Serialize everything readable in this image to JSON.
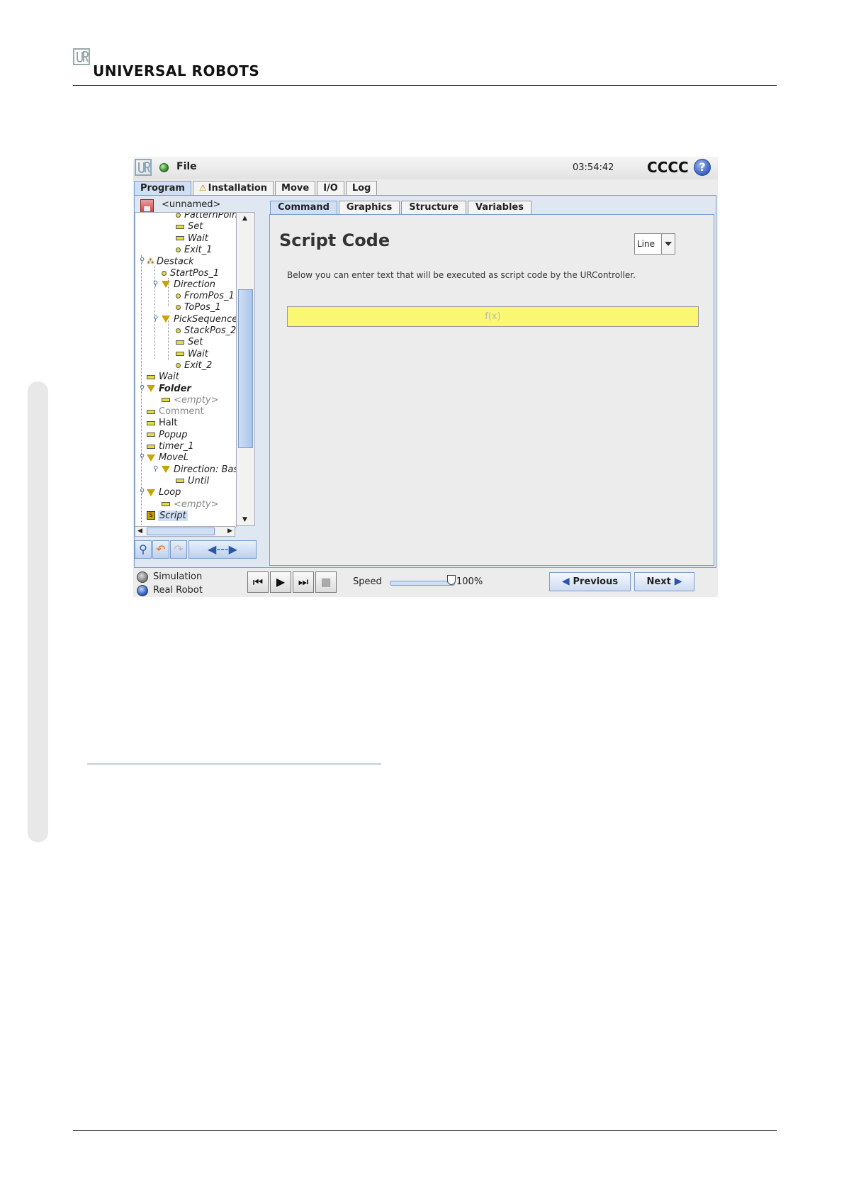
{
  "document": {
    "brand": "UNIVERSAL ROBOTS"
  },
  "screen": {
    "topbar": {
      "file_menu": "File",
      "time": "03:54:42",
      "robot_name": "CCCC",
      "help_icon": "question-circle-icon"
    },
    "main_tabs": [
      {
        "label": "Program",
        "active": true
      },
      {
        "label": "Installation",
        "warning": true
      },
      {
        "label": "Move"
      },
      {
        "label": "I/O"
      },
      {
        "label": "Log"
      }
    ],
    "program_name": "<unnamed>",
    "tree": [
      {
        "label": "PatternPoint",
        "style": "it",
        "node": "dot"
      },
      {
        "label": "Set",
        "style": "it",
        "node": "bar"
      },
      {
        "label": "Wait",
        "style": "it",
        "node": "bar"
      },
      {
        "label": "Exit_1",
        "style": "it",
        "node": "dot"
      },
      {
        "label": "Destack",
        "style": "it",
        "node": "cluster"
      },
      {
        "label": "StartPos_1",
        "style": "it",
        "node": "dot"
      },
      {
        "label": "Direction",
        "style": "it",
        "node": "tri"
      },
      {
        "label": "FromPos_1",
        "style": "it",
        "node": "dot"
      },
      {
        "label": "ToPos_1",
        "style": "it",
        "node": "dot"
      },
      {
        "label": "PickSequence",
        "style": "it",
        "node": "tri"
      },
      {
        "label": "StackPos_2",
        "style": "it",
        "node": "dot"
      },
      {
        "label": "Set",
        "style": "it",
        "node": "bar"
      },
      {
        "label": "Wait",
        "style": "it",
        "node": "bar"
      },
      {
        "label": "Exit_2",
        "style": "it",
        "node": "dot"
      },
      {
        "label": "Wait",
        "style": "it",
        "node": "bar"
      },
      {
        "label": "Folder",
        "style": "it bold",
        "node": "tri"
      },
      {
        "label": "<empty>",
        "style": "it gray",
        "node": "bar"
      },
      {
        "label": "Comment",
        "style": "gray",
        "node": "bar"
      },
      {
        "label": "Halt",
        "style": "",
        "node": "bar"
      },
      {
        "label": "Popup",
        "style": "it",
        "node": "bar"
      },
      {
        "label": "timer_1",
        "style": "it",
        "node": "bar"
      },
      {
        "label": "MoveL",
        "style": "it",
        "node": "tri"
      },
      {
        "label": "Direction: Base",
        "style": "it",
        "node": "tri"
      },
      {
        "label": "Until",
        "style": "it",
        "node": "bar"
      },
      {
        "label": "Loop",
        "style": "it",
        "node": "tri"
      },
      {
        "label": "<empty>",
        "style": "it gray",
        "node": "bar"
      },
      {
        "label": "Script",
        "style": "it",
        "node": "script",
        "selected": true
      }
    ],
    "sub_tabs": [
      {
        "label": "Command",
        "active": true
      },
      {
        "label": "Graphics"
      },
      {
        "label": "Structure"
      },
      {
        "label": "Variables"
      }
    ],
    "command": {
      "title": "Script Code",
      "mode_value": "Line",
      "description": "Below you can enter text that will be executed as script code by the URController.",
      "input_placeholder": "f(x)"
    },
    "footer": {
      "simulation_label": "Simulation",
      "real_robot_label": "Real Robot",
      "speed_label": "Speed",
      "speed_value": "100%",
      "speed_fraction": 1.0,
      "previous_label": "Previous",
      "next_label": "Next"
    }
  }
}
